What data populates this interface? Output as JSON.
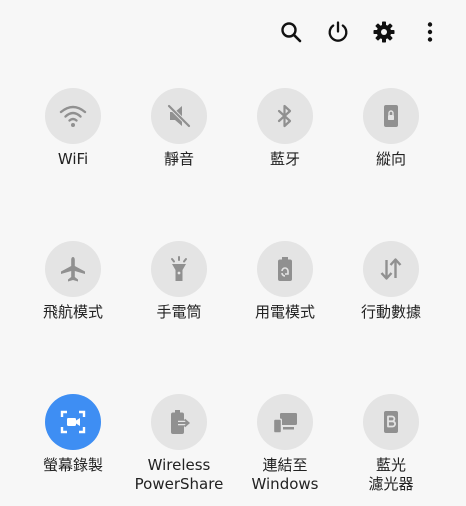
{
  "toolbar": {
    "search_icon": "search-icon",
    "power_icon": "power-icon",
    "settings_icon": "gear-icon",
    "more_icon": "more-vertical-icon"
  },
  "colors": {
    "background": "#f7f7f7",
    "tile_off": "#e4e4e4",
    "tile_on": "#3e8ef3",
    "icon_gray": "#909090",
    "icon_on": "#ffffff",
    "toolbar_icon": "#111111"
  },
  "tiles": [
    {
      "label": "WiFi",
      "icon": "wifi-icon",
      "active": false
    },
    {
      "label": "靜音",
      "icon": "mute-icon",
      "active": false
    },
    {
      "label": "藍牙",
      "icon": "bluetooth-icon",
      "active": false
    },
    {
      "label": "縱向",
      "icon": "portrait-lock-icon",
      "active": false
    },
    {
      "label": "飛航模式",
      "icon": "airplane-icon",
      "active": false
    },
    {
      "label": "手電筒",
      "icon": "flashlight-icon",
      "active": false
    },
    {
      "label": "用電模式",
      "icon": "battery-saver-icon",
      "active": false
    },
    {
      "label": "行動數據",
      "icon": "mobile-data-icon",
      "active": false
    },
    {
      "label": "螢幕錄製",
      "icon": "screen-recorder-icon",
      "active": true
    },
    {
      "label": "Wireless\nPowerShare",
      "icon": "wireless-powershare-icon",
      "active": false
    },
    {
      "label": "連結至\nWindows",
      "icon": "link-to-windows-icon",
      "active": false
    },
    {
      "label": "藍光\n濾光器",
      "icon": "blue-light-filter-icon",
      "active": false
    }
  ]
}
